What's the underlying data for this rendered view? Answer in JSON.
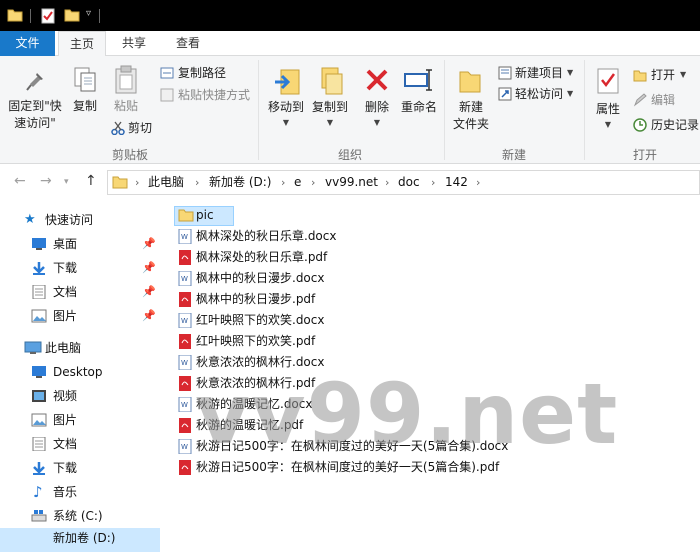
{
  "tabs": {
    "file": "文件",
    "home": "主页",
    "share": "共享",
    "view": "查看"
  },
  "ribbon": {
    "clipboard": {
      "pin": "固定到\"快\n速访问\"",
      "pin_l1": "固定到\"快",
      "pin_l2": "速访问\"",
      "copy": "复制",
      "paste": "粘贴",
      "copy_path": "复制路径",
      "paste_shortcut": "粘贴快捷方式",
      "cut": "剪切",
      "label": "剪贴板"
    },
    "organize": {
      "move_to": "移动到",
      "copy_to": "复制到",
      "delete": "删除",
      "rename": "重命名",
      "label": "组织"
    },
    "new": {
      "new_folder_l1": "新建",
      "new_folder_l2": "文件夹",
      "new_item": "新建项目",
      "easy_access": "轻松访问",
      "label": "新建"
    },
    "open": {
      "properties": "属性",
      "open": "打开",
      "edit": "编辑",
      "history": "历史记录",
      "label": "打开"
    }
  },
  "breadcrumb": [
    "此电脑",
    "新加卷 (D:)",
    "e",
    "vv99.net",
    "doc",
    "142"
  ],
  "nav": {
    "quick_access": "快速访问",
    "quick_items": [
      "桌面",
      "下载",
      "文档",
      "图片"
    ],
    "this_pc": "此电脑",
    "pc_items": [
      "Desktop",
      "视频",
      "图片",
      "文档",
      "下载",
      "音乐",
      "系统 (C:)",
      "新加卷 (D:)"
    ]
  },
  "files": [
    {
      "name": "pic",
      "type": "folder"
    },
    {
      "name": "枫林深处的秋日乐章.docx",
      "type": "docx"
    },
    {
      "name": "枫林深处的秋日乐章.pdf",
      "type": "pdf"
    },
    {
      "name": "枫林中的秋日漫步.docx",
      "type": "docx"
    },
    {
      "name": "枫林中的秋日漫步.pdf",
      "type": "pdf"
    },
    {
      "name": "红叶映照下的欢笑.docx",
      "type": "docx"
    },
    {
      "name": "红叶映照下的欢笑.pdf",
      "type": "pdf"
    },
    {
      "name": "秋意浓浓的枫林行.docx",
      "type": "docx"
    },
    {
      "name": "秋意浓浓的枫林行.pdf",
      "type": "pdf"
    },
    {
      "name": "秋游的温暖记忆.docx",
      "type": "docx"
    },
    {
      "name": "秋游的温暖记忆.pdf",
      "type": "pdf"
    },
    {
      "name": "秋游日记500字：在枫林间度过的美好一天(5篇合集).docx",
      "type": "docx"
    },
    {
      "name": "秋游日记500字：在枫林间度过的美好一天(5篇合集).pdf",
      "type": "pdf"
    }
  ],
  "watermark": "vv99.net",
  "colors": {
    "accent": "#1979ca",
    "selection": "#cce8ff",
    "folder": "#f8d775",
    "pdf": "#d9282f",
    "word": "#2b579a"
  }
}
